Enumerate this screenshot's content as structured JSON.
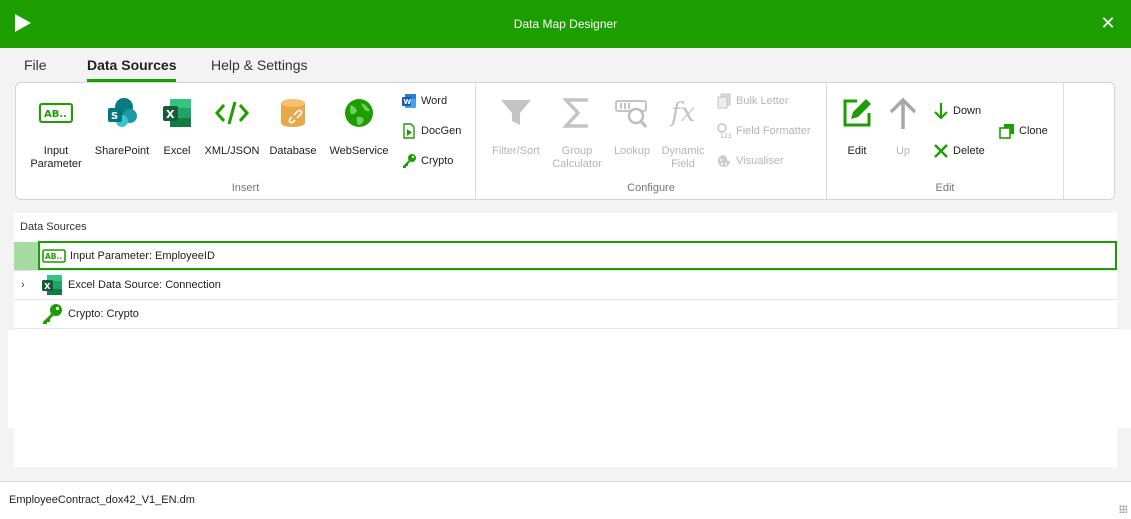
{
  "window": {
    "title": "Data Map Designer"
  },
  "tabs": [
    {
      "label": "File"
    },
    {
      "label": "Data Sources"
    },
    {
      "label": "Help & Settings"
    }
  ],
  "ribbon": {
    "insert": {
      "label": "Insert",
      "buttons": [
        {
          "label": "Input\nParameter",
          "icon": "input-parameter-icon"
        },
        {
          "label": "SharePoint",
          "icon": "sharepoint-icon"
        },
        {
          "label": "Excel",
          "icon": "excel-icon"
        },
        {
          "label": "XML/JSON",
          "icon": "code-icon"
        },
        {
          "label": "Database",
          "icon": "database-icon"
        },
        {
          "label": "WebService",
          "icon": "globe-icon"
        }
      ],
      "small": [
        {
          "label": "Word",
          "icon": "word-icon"
        },
        {
          "label": "DocGen",
          "icon": "docgen-icon"
        },
        {
          "label": "Crypto",
          "icon": "key-icon"
        }
      ]
    },
    "configure": {
      "label": "Configure",
      "buttons": [
        {
          "label": "Filter/Sort",
          "icon": "filter-icon"
        },
        {
          "label": "Group\nCalculator",
          "icon": "sigma-icon"
        },
        {
          "label": "Lookup",
          "icon": "lookup-icon"
        },
        {
          "label": "Dynamic\nField",
          "icon": "fx-icon"
        }
      ],
      "small": [
        {
          "label": "Bulk Letter",
          "icon": "bulk-letter-icon"
        },
        {
          "label": "Field Formatter",
          "icon": "field-formatter-icon"
        },
        {
          "label": "Visualiser",
          "icon": "visualiser-icon"
        }
      ]
    },
    "edit": {
      "label": "Edit",
      "buttons": [
        {
          "label": "Edit",
          "icon": "edit-icon"
        },
        {
          "label": "Up",
          "icon": "arrow-up-icon"
        }
      ],
      "small": [
        {
          "label": "Down",
          "icon": "arrow-down-icon"
        },
        {
          "label": "Delete",
          "icon": "delete-icon"
        },
        {
          "label": "Clone",
          "icon": "clone-icon"
        }
      ]
    }
  },
  "panel": {
    "title": "Data Sources",
    "rows": [
      {
        "label": "Input Parameter: EmployeeID",
        "icon": "input-parameter-icon"
      },
      {
        "label": "Excel Data Source: Connection",
        "icon": "excel-icon"
      },
      {
        "label": "Crypto: Crypto",
        "icon": "key-icon"
      }
    ]
  },
  "status": {
    "filename": "EmployeeContract_dox42_V1_EN.dm"
  },
  "colors": {
    "accent": "#1c9e00",
    "selected_gutter": "#a7dca0",
    "disabled": "#b5b5b5"
  }
}
